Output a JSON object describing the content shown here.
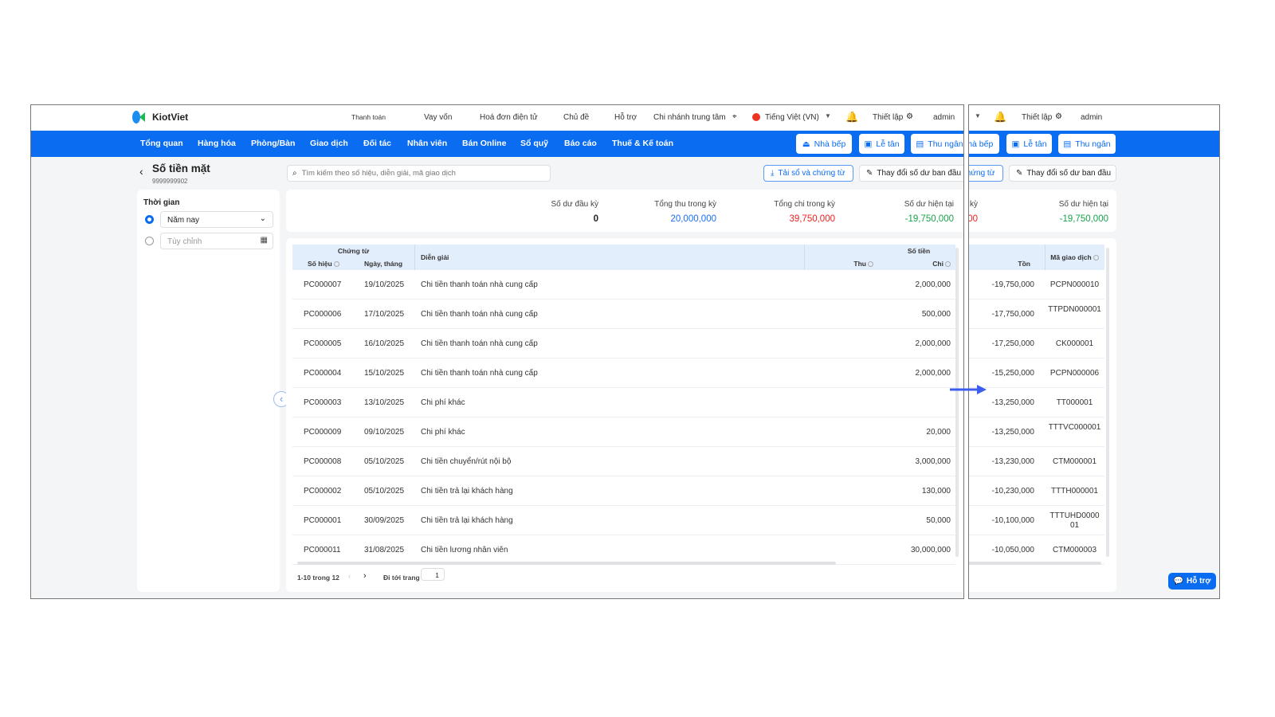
{
  "app": {
    "logo": "KiotViet"
  },
  "topbar": {
    "links": [
      "Thanh toán",
      "Vay vốn",
      "Hoá đơn điện tử",
      "Chủ đề",
      "Hỗ trợ",
      "Chi nhánh trung tâm",
      "Tiếng Việt (VN)"
    ],
    "settings": "Thiết lập",
    "user": "admin"
  },
  "nav": {
    "items": [
      "Tổng quan",
      "Hàng hóa",
      "Phòng/Bàn",
      "Giao dịch",
      "Đối tác",
      "Nhân viên",
      "Bán Online",
      "Sổ quỹ",
      "Báo cáo",
      "Thuế & Kế toán"
    ],
    "buttons": [
      "Nhà bếp",
      "Lễ tân",
      "Thu ngân"
    ]
  },
  "page": {
    "title": "Số tiền mặt",
    "subtitle": "9999999902",
    "search_placeholder": "Tìm kiếm theo số hiệu, diễn giải, mã giao dịch",
    "download_button": "Tải sổ và chứng từ",
    "change_balance_button": "Thay đổi số dư ban đầu"
  },
  "filter": {
    "title": "Thời gian",
    "option1": "Năm nay",
    "option2_placeholder": "Tùy chỉnh"
  },
  "summary": {
    "opening_label": "Số dư đầu kỳ",
    "opening": "0",
    "income_label": "Tổng thu trong kỳ",
    "income": "20,000,000",
    "expense_label": "Tổng chi trong kỳ",
    "expense": "39,750,000",
    "current_label": "Số dư hiện tại",
    "current": "-19,750,000"
  },
  "colors": {
    "income": "#1a6ff0",
    "expense": "#f01e1e",
    "current": "#17a34a"
  },
  "table": {
    "headers": {
      "group_voucher": "Chứng từ",
      "code": "Số hiệu",
      "date": "Ngày, tháng",
      "desc": "Diễn giải",
      "group_amount": "Số tiền",
      "thu": "Thu",
      "chi": "Chi",
      "ton": "Tồn",
      "ma": "Mã giao dịch"
    },
    "rows": [
      {
        "code": "PC000007",
        "date": "19/10/2025",
        "desc": "Chi tiền thanh toán nhà cung cấp",
        "thu": "",
        "chi": "2,000,000",
        "ton": "-19,750,000",
        "ma": "PCPN000010"
      },
      {
        "code": "PC000006",
        "date": "17/10/2025",
        "desc": "Chi tiền thanh toán nhà cung cấp",
        "thu": "",
        "chi": "500,000",
        "ton": "-17,750,000",
        "ma": "TTPDN000001"
      },
      {
        "code": "PC000005",
        "date": "16/10/2025",
        "desc": "Chi tiền thanh toán nhà cung cấp",
        "thu": "",
        "chi": "2,000,000",
        "ton": "-17,250,000",
        "ma": "CK000001"
      },
      {
        "code": "PC000004",
        "date": "15/10/2025",
        "desc": "Chi tiền thanh toán nhà cung cấp",
        "thu": "",
        "chi": "2,000,000",
        "ton": "-15,250,000",
        "ma": "PCPN000006"
      },
      {
        "code": "PC000003",
        "date": "13/10/2025",
        "desc": "Chi phí khác",
        "thu": "",
        "chi": "",
        "ton": "-13,250,000",
        "ma": "TT000001"
      },
      {
        "code": "PC000009",
        "date": "09/10/2025",
        "desc": "Chi phí khác",
        "thu": "",
        "chi": "20,000",
        "ton": "-13,250,000",
        "ma": "TTTVC000001"
      },
      {
        "code": "PC000008",
        "date": "05/10/2025",
        "desc": "Chi tiền chuyển/rút nội bộ",
        "thu": "",
        "chi": "3,000,000",
        "ton": "-13,230,000",
        "ma": "CTM000001"
      },
      {
        "code": "PC000002",
        "date": "05/10/2025",
        "desc": "Chi tiền trả lại khách hàng",
        "thu": "",
        "chi": "130,000",
        "ton": "-10,230,000",
        "ma": "TTTH000001"
      },
      {
        "code": "PC000001",
        "date": "30/09/2025",
        "desc": "Chi tiền trả lại khách hàng",
        "thu": "",
        "chi": "50,000",
        "ton": "-10,100,000",
        "ma": "TTTUHD000001"
      },
      {
        "code": "PC000011",
        "date": "31/08/2025",
        "desc": "Chi tiền lương nhân viên",
        "thu": "",
        "chi": "30,000,000",
        "ton": "-10,050,000",
        "ma": "CTM000003"
      }
    ]
  },
  "pagination": {
    "range": "1-10 trong 12",
    "goto_label": "Đi tới trang",
    "page": "1"
  },
  "support_button": "Hỗ trợ"
}
